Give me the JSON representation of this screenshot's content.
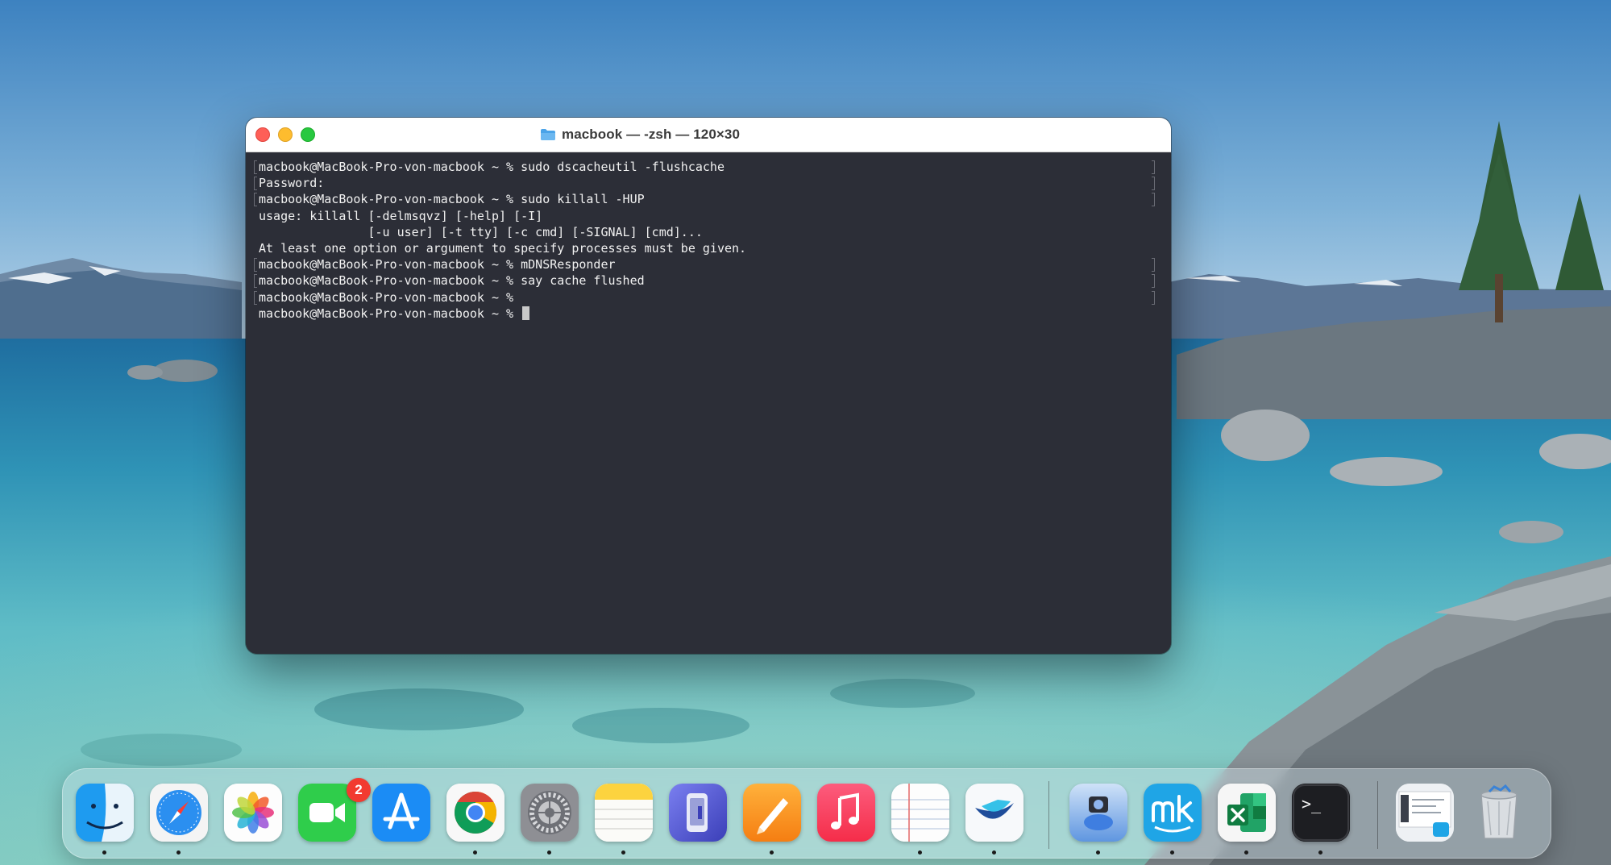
{
  "window": {
    "title": "macbook — -zsh — 120×30",
    "buttons": {
      "close": "close",
      "minimize": "minimize",
      "zoom": "zoom"
    }
  },
  "terminal": {
    "lines": [
      {
        "text": "macbook@MacBook-Pro-von-macbook ~ % sudo dscacheutil -flushcache",
        "marked": true
      },
      {
        "text": "Password:",
        "marked": true
      },
      {
        "text": "macbook@MacBook-Pro-von-macbook ~ % sudo killall -HUP",
        "marked": true
      },
      {
        "text": "usage: killall [-delmsqvz] [-help] [-I]",
        "marked": false
      },
      {
        "text": "               [-u user] [-t tty] [-c cmd] [-SIGNAL] [cmd]...",
        "marked": false
      },
      {
        "text": "At least one option or argument to specify processes must be given.",
        "marked": false
      },
      {
        "text": "macbook@MacBook-Pro-von-macbook ~ % mDNSResponder",
        "marked": true
      },
      {
        "text": "macbook@MacBook-Pro-von-macbook ~ % say cache flushed",
        "marked": true
      },
      {
        "text": "macbook@MacBook-Pro-von-macbook ~ %",
        "marked": true
      },
      {
        "text": "macbook@MacBook-Pro-von-macbook ~ % ",
        "marked": false,
        "cursor": true
      }
    ]
  },
  "dock": {
    "items": [
      {
        "name": "finder",
        "icon": "finder-icon",
        "running": true
      },
      {
        "name": "safari",
        "icon": "safari-icon",
        "running": true
      },
      {
        "name": "photos",
        "icon": "photos-icon",
        "running": false
      },
      {
        "name": "facetime",
        "icon": "facetime-icon",
        "running": false,
        "badge": "2"
      },
      {
        "name": "app-store",
        "icon": "app-store-icon",
        "running": false
      },
      {
        "name": "chrome",
        "icon": "chrome-icon",
        "running": true
      },
      {
        "name": "system-settings",
        "icon": "gear-icon",
        "running": true
      },
      {
        "name": "notes",
        "icon": "notes-icon",
        "running": true
      },
      {
        "name": "configurator",
        "icon": "device-icon",
        "running": false
      },
      {
        "name": "pages",
        "icon": "pages-icon",
        "running": true
      },
      {
        "name": "music",
        "icon": "music-icon",
        "running": false
      },
      {
        "name": "notebook",
        "icon": "notebook-icon",
        "running": true
      },
      {
        "name": "mail-client",
        "icon": "paper-plane-icon",
        "running": true
      },
      {
        "name": "lens-app",
        "icon": "lens-icon",
        "running": true
      },
      {
        "name": "mk-app",
        "icon": "mk-icon",
        "running": true
      },
      {
        "name": "excel",
        "icon": "excel-icon",
        "running": true
      },
      {
        "name": "terminal",
        "icon": "terminal-icon",
        "running": true,
        "glyph": ">_"
      },
      {
        "name": "screenshot-stack",
        "icon": "screenshot-thumbnail-icon",
        "running": false
      },
      {
        "name": "trash",
        "icon": "trash-icon",
        "running": false
      }
    ]
  },
  "colors": {
    "terminal_bg": "#2c2e37",
    "terminal_text": "#f1f1f1",
    "badge": "#f23a30"
  }
}
